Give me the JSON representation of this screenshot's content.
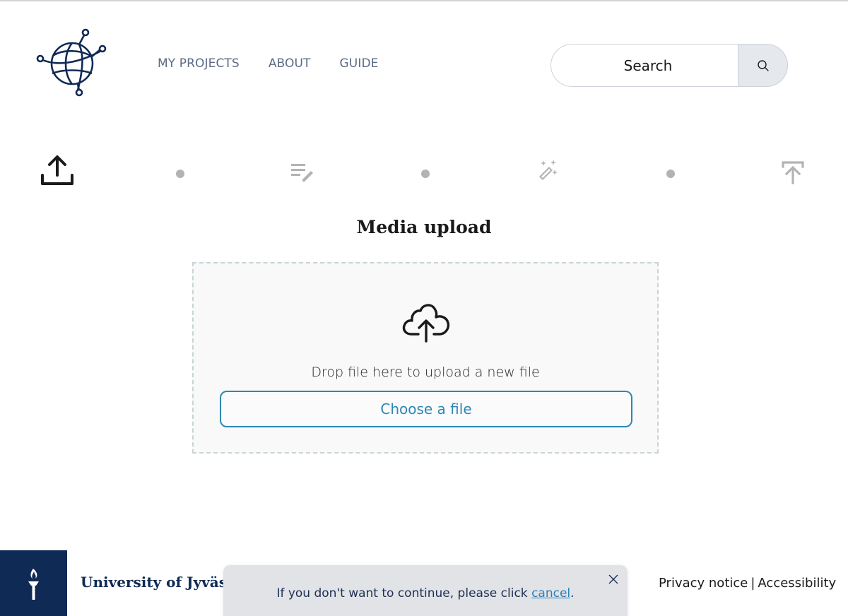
{
  "header": {
    "logo_icon": "globe-network-icon",
    "nav": [
      {
        "label": "MY PROJECTS"
      },
      {
        "label": "ABOUT"
      },
      {
        "label": "GUIDE"
      }
    ],
    "search": {
      "placeholder": "Search",
      "value": "",
      "button_icon": "search-icon"
    }
  },
  "stepper": {
    "steps": [
      {
        "icon": "upload-icon",
        "state": "active",
        "color": "#1a1a1a"
      },
      {
        "icon": "edit-text-icon",
        "state": "inactive",
        "color": "#b3b3b3"
      },
      {
        "icon": "magic-wand-icon",
        "state": "inactive",
        "color": "#b3b3b3"
      },
      {
        "icon": "publish-icon",
        "state": "inactive",
        "color": "#b3b3b3"
      }
    ]
  },
  "main": {
    "title": "Media upload",
    "dropzone": {
      "icon": "cloud-upload-icon",
      "text": "Drop file here to upload a new file",
      "button_label": "Choose a file"
    }
  },
  "footer": {
    "logo_icon": "torch-icon",
    "university_name": "University of Jyväsk",
    "links": [
      {
        "label": "Privacy notice"
      },
      {
        "label": "Accessibility"
      }
    ],
    "separator": "|"
  },
  "toast": {
    "message_prefix": "If you don't want to continue, please click ",
    "link_label": "cancel",
    "message_suffix": ".",
    "close_icon": "close-icon"
  },
  "colors": {
    "brand_navy": "#0f2a55",
    "accent_blue": "#2d88b3",
    "nav_text": "#5b6b86",
    "inactive_gray": "#b3b3b3"
  }
}
